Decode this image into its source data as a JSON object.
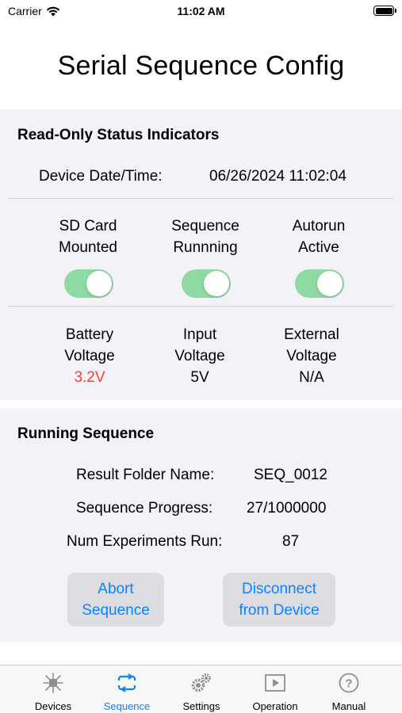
{
  "status_bar": {
    "carrier": "Carrier",
    "time": "11:02 AM"
  },
  "header": {
    "title": "Serial Sequence Config"
  },
  "status_section": {
    "title": "Read-Only Status Indicators",
    "datetime_label": "Device Date/Time:",
    "datetime_value": "06/26/2024 11:02:04",
    "toggles": [
      {
        "line1": "SD Card",
        "line2": "Mounted",
        "on": true
      },
      {
        "line1": "Sequence",
        "line2": "Runnning",
        "on": true
      },
      {
        "line1": "Autorun",
        "line2": "Active",
        "on": true
      }
    ],
    "voltages": [
      {
        "line1": "Battery",
        "line2": "Voltage",
        "value": "3.2V",
        "color": "#ff3b30"
      },
      {
        "line1": "Input",
        "line2": "Voltage",
        "value": "5V",
        "color": "#000000"
      },
      {
        "line1": "External",
        "line2": "Voltage",
        "value": "N/A",
        "color": "#000000"
      }
    ]
  },
  "running_section": {
    "title": "Running Sequence",
    "rows": [
      {
        "label": "Result Folder Name:",
        "value": "SEQ_0012"
      },
      {
        "label": "Sequence Progress:",
        "value": "27/1000000"
      },
      {
        "label": "Num Experiments Run:",
        "value": "87"
      }
    ],
    "abort_button": {
      "line1": "Abort",
      "line2": "Sequence"
    },
    "disconnect_button": {
      "line1": "Disconnect",
      "line2": "from Device"
    }
  },
  "tabbar": {
    "accent": "#0a84ff",
    "tabs": [
      {
        "label": "Devices",
        "icon": "devices-icon",
        "active": false
      },
      {
        "label": "Sequence",
        "icon": "sequence-icon",
        "active": true
      },
      {
        "label": "Settings",
        "icon": "settings-icon",
        "active": false
      },
      {
        "label": "Operation",
        "icon": "operation-icon",
        "active": false
      },
      {
        "label": "Manual",
        "icon": "manual-icon",
        "active": false
      }
    ]
  }
}
